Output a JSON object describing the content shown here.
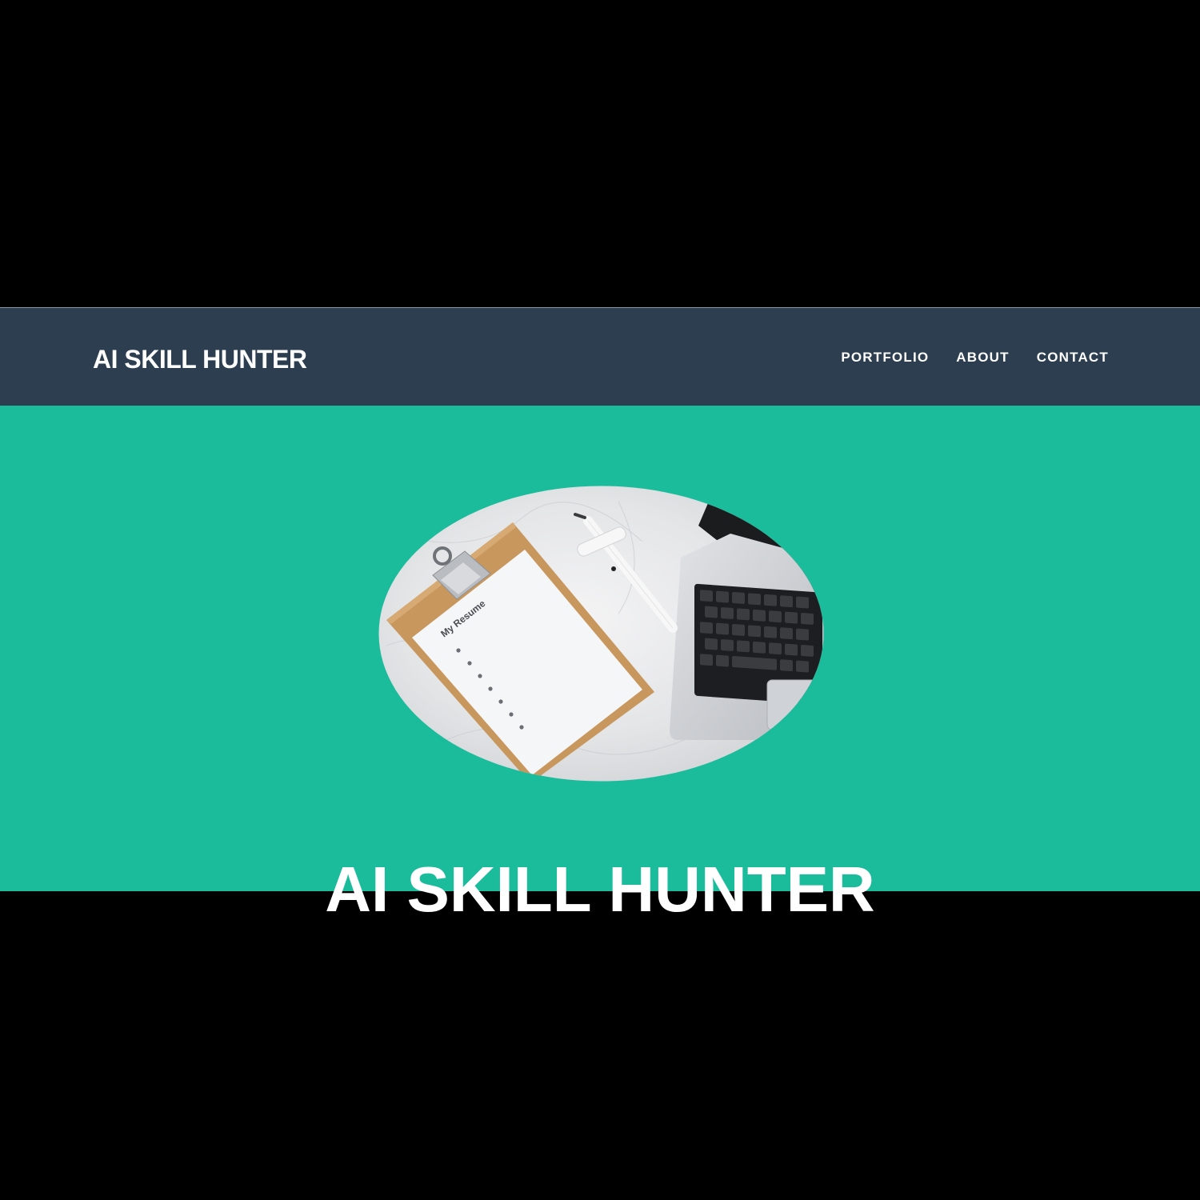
{
  "navbar": {
    "brand": "AI SKILL HUNTER",
    "links": [
      "PORTFOLIO",
      "ABOUT",
      "CONTACT"
    ]
  },
  "hero": {
    "image": {
      "subject": "clipboard-resume-pen-laptop-photo",
      "resume_label": "My Resume"
    },
    "title": "AI SKILL HUNTER"
  },
  "colors": {
    "background": "#000000",
    "navbar": "#2c3e50",
    "hero": "#1abc9c",
    "text": "#ffffff"
  }
}
